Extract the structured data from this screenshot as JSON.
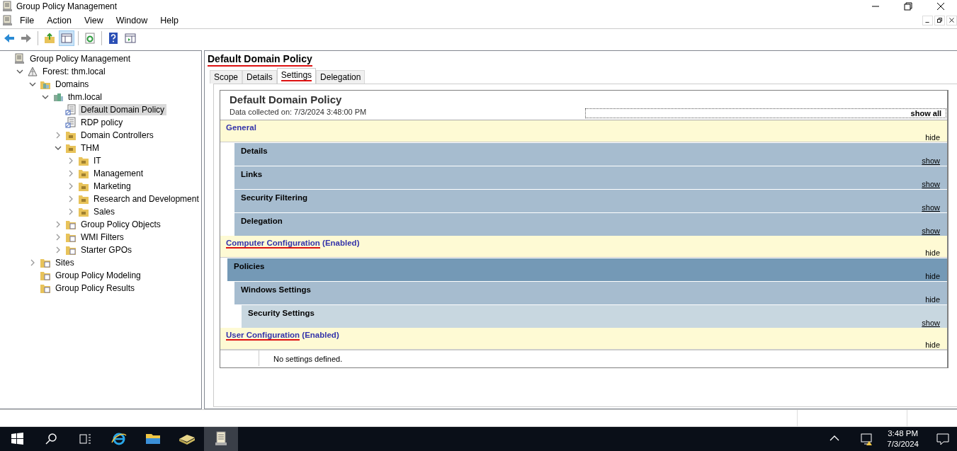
{
  "window": {
    "title": "Group Policy Management"
  },
  "menu": [
    "File",
    "Action",
    "View",
    "Window",
    "Help"
  ],
  "toolbar": [
    {
      "kind": "back",
      "pressed": false
    },
    {
      "kind": "forward",
      "pressed": false
    },
    {
      "kind": "sep"
    },
    {
      "kind": "up",
      "pressed": false
    },
    {
      "kind": "tree",
      "pressed": true
    },
    {
      "kind": "sep"
    },
    {
      "kind": "refresh",
      "pressed": false
    },
    {
      "kind": "sep"
    },
    {
      "kind": "help",
      "pressed": false
    },
    {
      "kind": "pane",
      "pressed": false
    }
  ],
  "tree": [
    {
      "label": "Group Policy Management",
      "kind": "console",
      "selected": false,
      "children": [
        {
          "label": "Forest: thm.local",
          "kind": "forest",
          "expanded": true,
          "selected": false,
          "children": [
            {
              "label": "Domains",
              "kind": "domains",
              "expanded": true,
              "selected": false,
              "children": [
                {
                  "label": "thm.local",
                  "kind": "domain",
                  "expanded": true,
                  "selected": false,
                  "children": [
                    {
                      "label": "Default Domain Policy",
                      "kind": "gpo",
                      "selected": true
                    },
                    {
                      "label": "RDP policy",
                      "kind": "gpo",
                      "selected": false
                    },
                    {
                      "label": "Domain Controllers",
                      "kind": "ou",
                      "expanded": false,
                      "selected": false
                    },
                    {
                      "label": "THM",
                      "kind": "ou",
                      "expanded": true,
                      "selected": false,
                      "children": [
                        {
                          "label": "IT",
                          "kind": "ou",
                          "expanded": false,
                          "selected": false
                        },
                        {
                          "label": "Management",
                          "kind": "ou",
                          "expanded": false,
                          "selected": false
                        },
                        {
                          "label": "Marketing",
                          "kind": "ou",
                          "expanded": false,
                          "selected": false
                        },
                        {
                          "label": "Research and Development",
                          "kind": "ou",
                          "expanded": false,
                          "selected": false
                        },
                        {
                          "label": "Sales",
                          "kind": "ou",
                          "expanded": false,
                          "selected": false
                        }
                      ]
                    },
                    {
                      "label": "Group Policy Objects",
                      "kind": "folder",
                      "expanded": false,
                      "selected": false
                    },
                    {
                      "label": "WMI Filters",
                      "kind": "folder",
                      "expanded": false,
                      "selected": false
                    },
                    {
                      "label": "Starter GPOs",
                      "kind": "folder",
                      "expanded": false,
                      "selected": false
                    }
                  ]
                }
              ]
            },
            {
              "label": "Sites",
              "kind": "folder",
              "expanded": false,
              "selected": false
            },
            {
              "label": "Group Policy Modeling",
              "kind": "folder",
              "selected": false
            },
            {
              "label": "Group Policy Results",
              "kind": "folder",
              "selected": false
            }
          ]
        }
      ]
    }
  ],
  "details": {
    "title": "Default Domain Policy",
    "title_marked": true,
    "tabs": [
      {
        "label": "Scope",
        "selected": false,
        "marked": false
      },
      {
        "label": "Details",
        "selected": false,
        "marked": false
      },
      {
        "label": "Settings",
        "selected": true,
        "marked": true
      },
      {
        "label": "Delegation",
        "selected": false,
        "marked": false
      }
    ],
    "report": {
      "title": "Default Domain Policy",
      "collected": "Data collected on: 7/3/2024 3:48:00 PM",
      "show_all": "show all",
      "sections": [
        {
          "title": "General",
          "toggle": "hide",
          "marked": false,
          "children": [
            {
              "title": "Details",
              "kind": "section",
              "toggle": "show"
            },
            {
              "title": "Links",
              "kind": "section",
              "toggle": "show"
            },
            {
              "title": "Security Filtering",
              "kind": "section",
              "toggle": "show"
            },
            {
              "title": "Delegation",
              "kind": "section",
              "toggle": "show"
            }
          ]
        },
        {
          "title": "Computer Configuration",
          "suffix": "(Enabled)",
          "toggle": "hide",
          "marked": true,
          "children": [
            {
              "title": "Policies",
              "kind": "category",
              "toggle": "hide"
            },
            {
              "title": "Windows Settings",
              "kind": "section",
              "toggle": "hide"
            },
            {
              "title": "Security Settings",
              "kind": "subsection",
              "toggle": "show"
            }
          ]
        },
        {
          "title": "User Configuration",
          "suffix": "(Enabled)",
          "toggle": "hide",
          "marked": true,
          "note": "No settings defined."
        }
      ]
    }
  },
  "taskbar": {
    "apps": [
      {
        "kind": "ie",
        "active": false
      },
      {
        "kind": "explorer",
        "active": false
      },
      {
        "kind": "server",
        "active": false
      },
      {
        "kind": "gpm",
        "active": true
      }
    ],
    "time": "3:48 PM",
    "date": "7/3/2024"
  }
}
